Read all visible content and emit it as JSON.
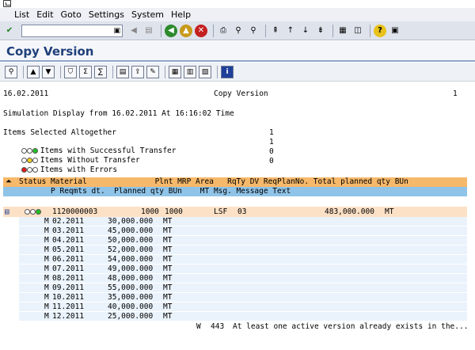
{
  "menu": {
    "items": [
      "List",
      "Edit",
      "Goto",
      "Settings",
      "System",
      "Help"
    ]
  },
  "toolbar": {
    "command_placeholder": ""
  },
  "page": {
    "title": "Copy Version"
  },
  "report": {
    "date": "16.02.2011",
    "header_title": "Copy Version",
    "page_no": "1",
    "simulation_line": "Simulation Display from 16.02.2011 At 16:16:02 Time",
    "summary": [
      {
        "label": "Items Selected Altogether",
        "value": "1"
      },
      {
        "label": "Items with Successful Transfer",
        "value": "1"
      },
      {
        "label": "Items Without Transfer",
        "value": "0"
      },
      {
        "label": "Items with Errors",
        "value": "0"
      }
    ],
    "columns_line1": "Status Material               Plnt MRP Area   RqTy DV ReqPlanNo. Total planned qty BUn",
    "columns_line2": "       P Reqmts dt.  Planned qty BUn    MT Msg. Message Text",
    "main_row": {
      "material": "1120000003",
      "plant": "1000",
      "mrp_area": "1000",
      "rqty": "LSF",
      "dv": "03",
      "total_qty": "483,000.000",
      "bun": "MT"
    },
    "rows": [
      {
        "p": "M",
        "date": "02.2011",
        "qty": "30,000.000",
        "bun": "MT"
      },
      {
        "p": "M",
        "date": "03.2011",
        "qty": "45,000.000",
        "bun": "MT"
      },
      {
        "p": "M",
        "date": "04.2011",
        "qty": "50,000.000",
        "bun": "MT"
      },
      {
        "p": "M",
        "date": "05.2011",
        "qty": "52,000.000",
        "bun": "MT"
      },
      {
        "p": "M",
        "date": "06.2011",
        "qty": "54,000.000",
        "bun": "MT"
      },
      {
        "p": "M",
        "date": "07.2011",
        "qty": "49,000.000",
        "bun": "MT"
      },
      {
        "p": "M",
        "date": "08.2011",
        "qty": "48,000.000",
        "bun": "MT"
      },
      {
        "p": "M",
        "date": "09.2011",
        "qty": "55,000.000",
        "bun": "MT"
      },
      {
        "p": "M",
        "date": "10.2011",
        "qty": "35,000.000",
        "bun": "MT"
      },
      {
        "p": "M",
        "date": "11.2011",
        "qty": "40,000.000",
        "bun": "MT"
      },
      {
        "p": "M",
        "date": "12.2011",
        "qty": "25,000.000",
        "bun": "MT"
      }
    ],
    "message": {
      "mt": "W",
      "no": "443",
      "text": "At least one active version already exists in the..."
    }
  }
}
